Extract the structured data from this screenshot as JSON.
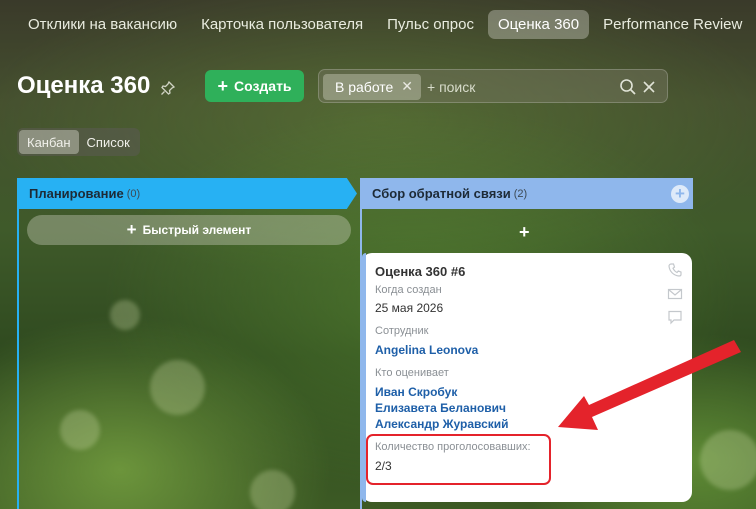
{
  "top_tabs": [
    {
      "label": "Отклики на вакансию",
      "active": false
    },
    {
      "label": "Карточка пользователя",
      "active": false
    },
    {
      "label": "Пульс опрос",
      "active": false
    },
    {
      "label": "Оценка 360",
      "active": true
    },
    {
      "label": "Performance Review",
      "active": false
    }
  ],
  "header": {
    "title": "Оценка 360",
    "create_label": "Создать",
    "filter_chip": "В работе",
    "search_placeholder": "+ поиск"
  },
  "view_switch": {
    "kanban": "Канбан",
    "list": "Список",
    "active": "Канбан"
  },
  "columns": [
    {
      "title": "Планирование",
      "count": "(0)",
      "color": "#27b1f3",
      "quick_add": "Быстрый элемент"
    },
    {
      "title": "Сбор обратной связи",
      "count": "(2)",
      "color": "#8fb7ec"
    }
  ],
  "card": {
    "title": "Оценка 360 #6",
    "created_label": "Когда создан",
    "created_value": "25 мая 2026",
    "employee_label": "Сотрудник",
    "employee": "Angelina Leonova",
    "raters_label": "Кто оценивает",
    "raters": [
      "Иван Скробук",
      "Елизавета Беланович",
      "Александр Журавский"
    ],
    "votes_label": "Количество проголосовавших:",
    "votes_value": "2/3"
  },
  "colors": {
    "accent_green": "#2fb05a",
    "highlight_red": "#e4232b",
    "link_blue": "#1e5fa8"
  }
}
